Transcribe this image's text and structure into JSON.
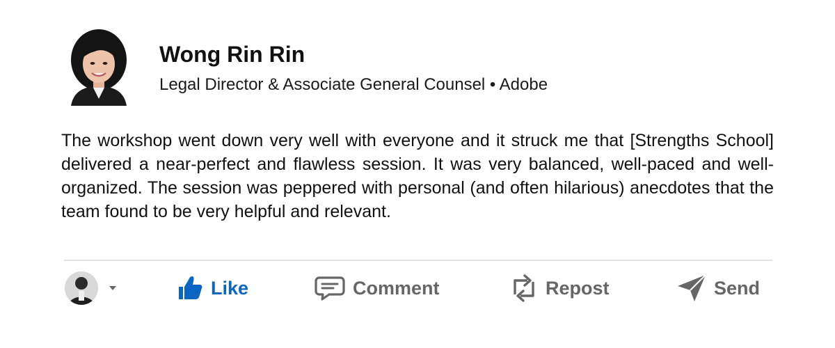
{
  "post": {
    "author_name": "Wong Rin Rin",
    "author_subtitle": "Legal Director & Associate General Counsel • Adobe",
    "text": "The workshop went down very well with everyone and it struck me that [Strengths School] delivered a near-perfect and flawless session. It was very balanced, well-paced and well-organized. The session was peppered with personal (and often hilarious) anecdotes that the team found to be very helpful and relevant."
  },
  "actions": {
    "like_label": "Like",
    "comment_label": "Comment",
    "repost_label": "Repost",
    "send_label": "Send"
  },
  "icons": {
    "like": "thumbs-up-icon",
    "comment": "comment-bubble-icon",
    "repost": "repost-arrows-icon",
    "send": "paper-plane-icon",
    "persona": "user-avatar-dropdown"
  },
  "colors": {
    "accent": "#0a66c2",
    "action_gray": "#666666",
    "divider": "#e2e2e2"
  }
}
